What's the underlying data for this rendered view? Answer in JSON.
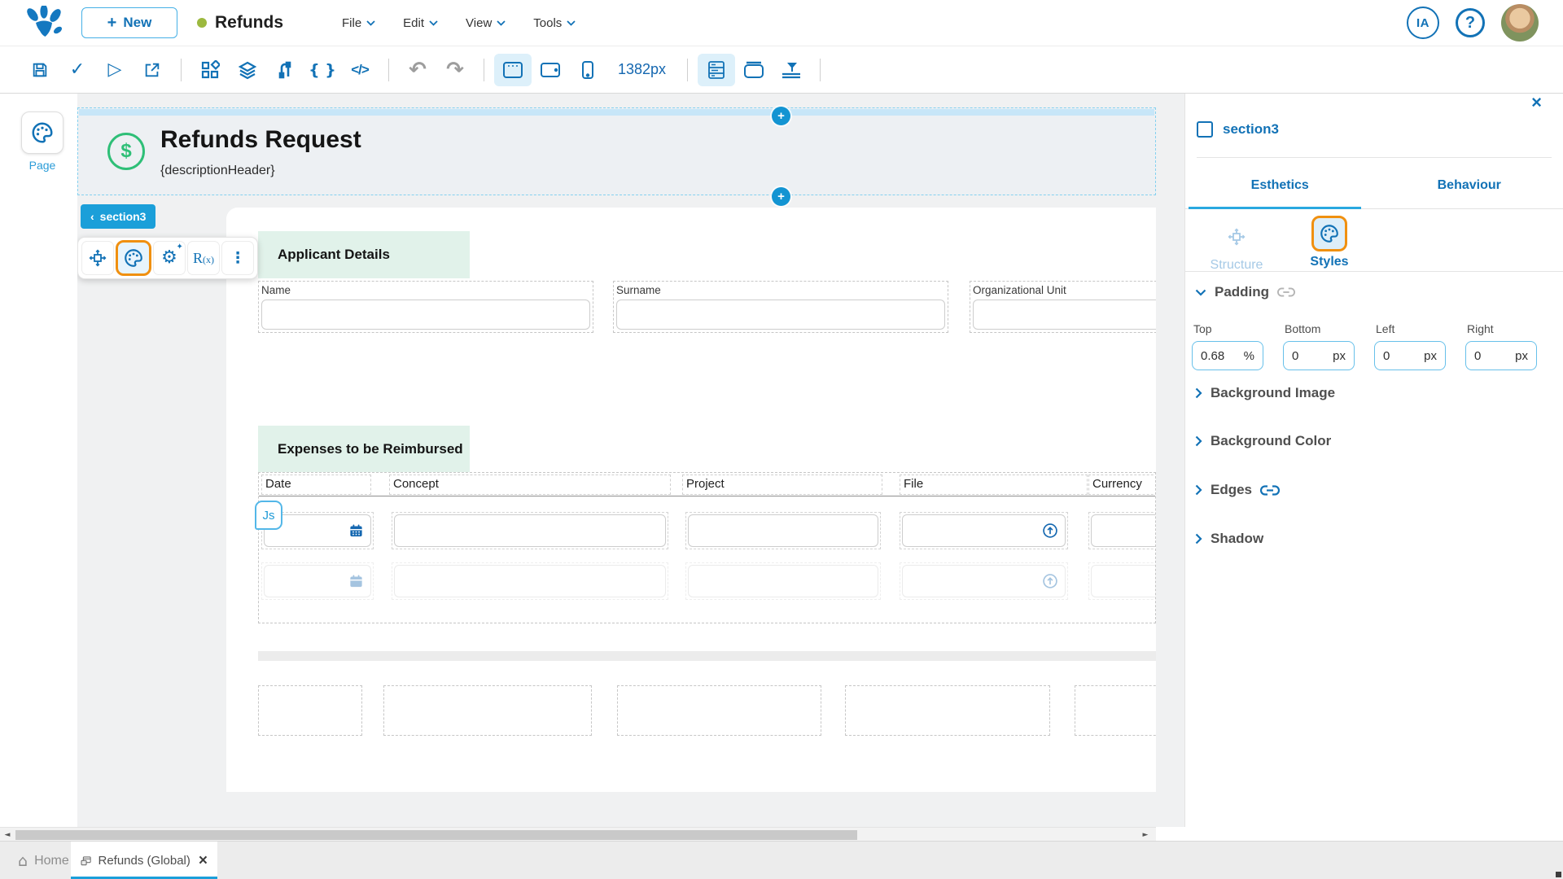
{
  "topbar": {
    "new_label": "New",
    "doc_title": "Refunds",
    "doc_status_color": "#9cb93f",
    "menus": [
      {
        "label": "File"
      },
      {
        "label": "Edit"
      },
      {
        "label": "View"
      },
      {
        "label": "Tools"
      }
    ],
    "ia_label": "IA",
    "help_label": "?"
  },
  "toolbar": {
    "braces_label": "{ }",
    "code_label": "</>",
    "undo_glyph": "↶",
    "redo_glyph": "↷",
    "check_glyph": "✓",
    "play_glyph": "▷",
    "viewport_width_label": "1382px"
  },
  "canvas": {
    "page_rail_label": "Page",
    "header": {
      "title": "Refunds Request",
      "subtitle": "{descriptionHeader}",
      "dollar_glyph": "$"
    },
    "selection_badge": {
      "chevron": "‹",
      "label": "section3"
    },
    "floating_toolbar": {
      "gear_glyph": "⚙",
      "sparkle_glyph": "✦",
      "rx_main": "R",
      "rx_sub": "(x)",
      "kebab_glyph": "⋮"
    },
    "handle_plus": "+",
    "js_badge": "Js",
    "applicant_group": {
      "title": "Applicant Details",
      "fields": [
        {
          "label": "Name",
          "value": ""
        },
        {
          "label": "Surname",
          "value": ""
        },
        {
          "label": "Organizational Unit",
          "value": ""
        }
      ]
    },
    "expenses_group": {
      "title": "Expenses to be Reimbursed",
      "columns": [
        "Date",
        "Concept",
        "Project",
        "File",
        "Currency"
      ],
      "rows": [
        {
          "date": "",
          "concept": "",
          "project": "",
          "file": "",
          "currency": ""
        },
        {
          "date": "",
          "concept": "",
          "project": "",
          "file": "",
          "currency": ""
        }
      ]
    }
  },
  "panel": {
    "close_glyph": "×",
    "selection_title": "section3",
    "tabs": [
      {
        "label": "Esthetics",
        "active": true
      },
      {
        "label": "Behaviour",
        "active": false
      }
    ],
    "tools": [
      {
        "label": "Structure",
        "active": false
      },
      {
        "label": "Styles",
        "active": true
      }
    ],
    "padding": {
      "title": "Padding",
      "fields": [
        {
          "label": "Top",
          "value": "0.68",
          "unit": "%"
        },
        {
          "label": "Bottom",
          "value": "0",
          "unit": "px"
        },
        {
          "label": "Left",
          "value": "0",
          "unit": "px"
        },
        {
          "label": "Right",
          "value": "0",
          "unit": "px"
        }
      ]
    },
    "sections": [
      {
        "label": "Background Image",
        "linked": false
      },
      {
        "label": "Background Color",
        "linked": false
      },
      {
        "label": "Edges",
        "linked": true
      },
      {
        "label": "Shadow",
        "linked": false
      }
    ]
  },
  "statusbar": {
    "scroll_left_glyph": "◄",
    "scroll_right_glyph": "►",
    "home_glyph": "⌂",
    "home_label": "Home",
    "doc_tab_label": "Refunds (Global)",
    "tab_close_glyph": "×"
  },
  "colors": {
    "primary_blue": "#1272b6",
    "cyan_accent": "#1b9fd9",
    "orange_highlight": "#f09010",
    "mint_highlight": "#e1f2ea",
    "green_icon": "#2ebf77",
    "status_dot": "#9cb93f"
  }
}
